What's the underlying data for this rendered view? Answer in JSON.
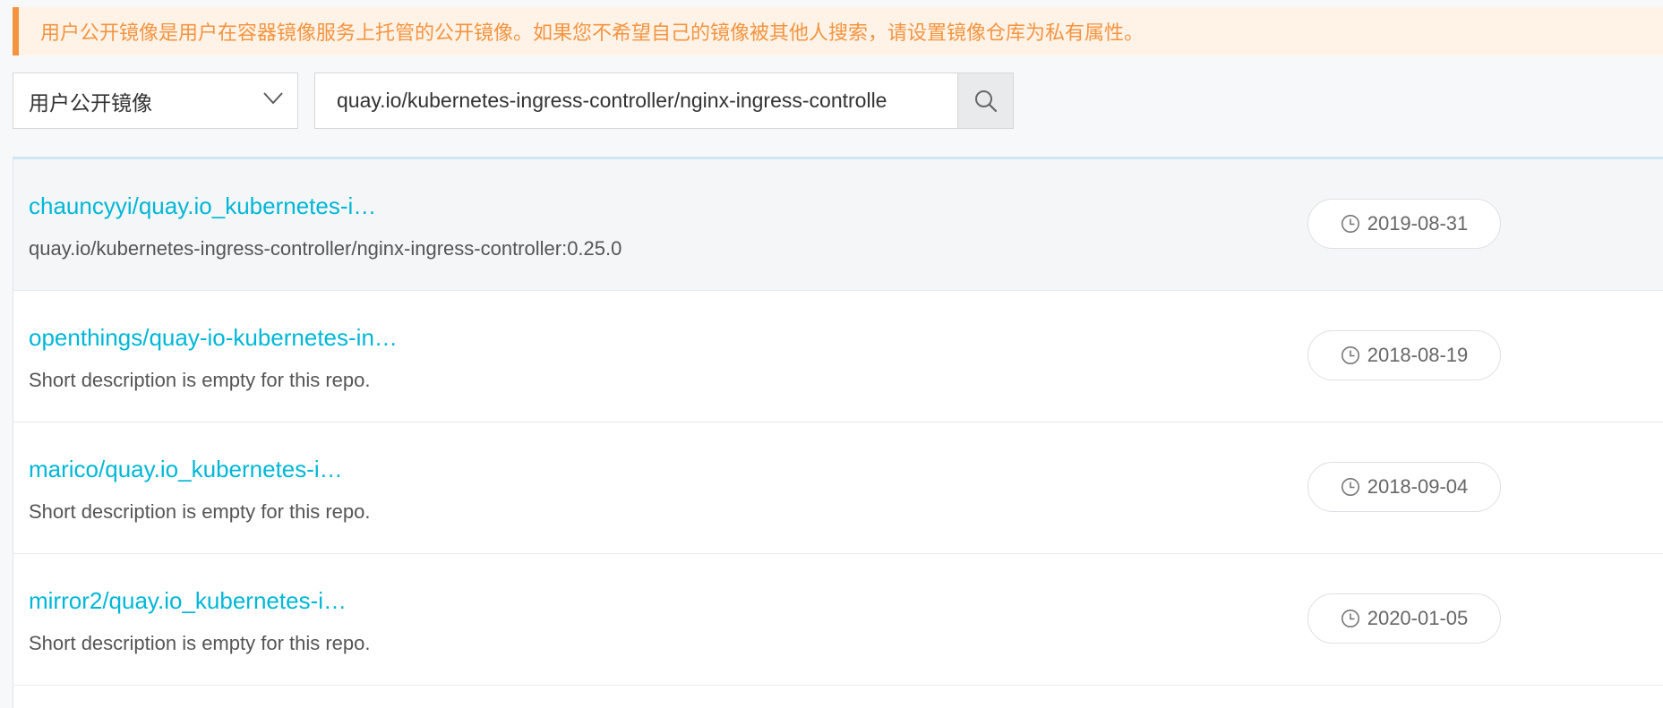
{
  "notice": {
    "text": "用户公开镜像是用户在容器镜像服务上托管的公开镜像。如果您不希望自己的镜像被其他人搜索，请设置镜像仓库为私有属性。"
  },
  "filter": {
    "selected": "用户公开镜像"
  },
  "search": {
    "value": "quay.io/kubernetes-ingress-controller/nginx-ingress-controlle"
  },
  "results": [
    {
      "name": "chauncyyi/quay.io_kubernetes-i…",
      "description": "quay.io/kubernetes-ingress-controller/nginx-ingress-controller:0.25.0",
      "date": "2019-08-31"
    },
    {
      "name": "openthings/quay-io-kubernetes-in…",
      "description": "Short description is empty for this repo.",
      "date": "2018-08-19"
    },
    {
      "name": "marico/quay.io_kubernetes-i…",
      "description": "Short description is empty for this repo.",
      "date": "2018-09-04"
    },
    {
      "name": "mirror2/quay.io_kubernetes-i…",
      "description": "Short description is empty for this repo.",
      "date": "2020-01-05"
    }
  ],
  "colors": {
    "notice_accent": "#f5943f",
    "notice_bg": "#fff3e8",
    "link": "#00b7d7",
    "active_row_bg": "#f5f6f8"
  },
  "icons": {
    "select_arrow": "chevron-down-icon",
    "search": "search-icon",
    "date": "clock-icon"
  }
}
